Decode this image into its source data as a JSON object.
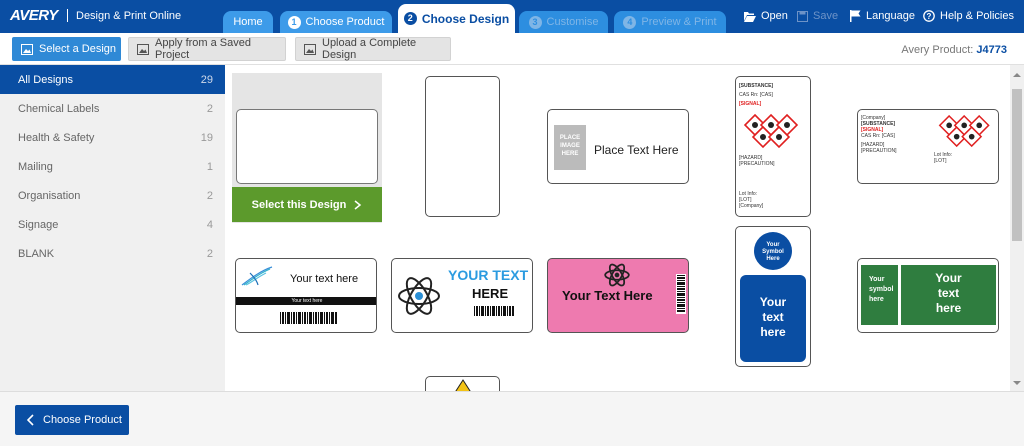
{
  "header": {
    "logo": "AVERY",
    "app_title": "Design & Print Online",
    "tabs": [
      {
        "label": "Home",
        "state": "normal"
      },
      {
        "num": "1",
        "label": "Choose Product",
        "state": "normal"
      },
      {
        "num": "2",
        "label": "Choose Design",
        "state": "active"
      },
      {
        "num": "3",
        "label": "Customise",
        "state": "disabled"
      },
      {
        "num": "4",
        "label": "Preview & Print",
        "state": "disabled"
      }
    ],
    "actions": {
      "open": "Open",
      "save": "Save",
      "language": "Language",
      "help": "Help & Policies"
    }
  },
  "toolbar": {
    "select_design": "Select a Design",
    "apply_saved": "Apply from a Saved Project",
    "upload_complete": "Upload a Complete Design",
    "product_label": "Avery Product:",
    "product_code": "J4773"
  },
  "sidebar": {
    "categories": [
      {
        "label": "All Designs",
        "count": "29"
      },
      {
        "label": "Chemical Labels",
        "count": "2"
      },
      {
        "label": "Health & Safety",
        "count": "19"
      },
      {
        "label": "Mailing",
        "count": "1"
      },
      {
        "label": "Organisation",
        "count": "2"
      },
      {
        "label": "Signage",
        "count": "4"
      },
      {
        "label": "BLANK",
        "count": "2"
      }
    ]
  },
  "designs": {
    "select_this_design": "Select this Design",
    "place_image_here": "PLACE IMAGE HERE",
    "place_text_here": "Place Text Here",
    "chem1": {
      "substance": "[SUBSTANCE]",
      "cas": "CAS Rn:  [CAS]",
      "signal": "[SIGNAL]",
      "hazard": "[HAZARD]",
      "precaution": "[PRECAUTION]",
      "lot_info": "Lot Info:",
      "lot": "[LOT]",
      "company": "[Company]"
    },
    "chem2": {
      "company": "[Company]",
      "substance": "[SUBSTANCE]",
      "signal": "[SIGNAL]",
      "cas": "CAS Rn:  [CAS]",
      "hazard": "[HAZARD]",
      "precaution": "[PRECAUTION]",
      "lot_info": "Lot Info:",
      "lot": "[LOT]"
    },
    "row2": {
      "your_text_here": "Your text here",
      "your_text_here_small": "Your text here",
      "your_text": "YOUR TEXT",
      "here": "HERE",
      "pink_text": "Your Text Here",
      "symbol_here": "Your Symbol Here",
      "your": "Your",
      "text": "text",
      "here_lc": "here",
      "your_symbol_here": "Your symbol here"
    }
  },
  "footer": {
    "back_label": "Choose Product"
  },
  "colors": {
    "brand_blue": "#0a4ea3",
    "tab_blue": "#3d9be9",
    "select_green": "#5c9a2c",
    "pink": "#ee7aaf",
    "sign_green": "#2f7d3f",
    "hazard_red": "#e02020"
  }
}
